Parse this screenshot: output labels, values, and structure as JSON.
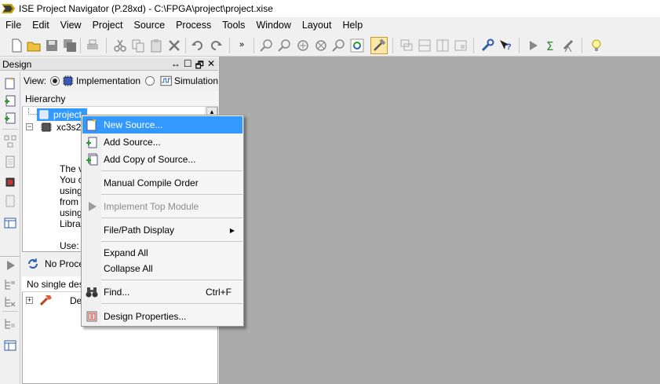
{
  "window": {
    "title": "ISE Project Navigator (P.28xd) - C:\\FPGA\\project\\project.xise"
  },
  "menu": [
    "File",
    "Edit",
    "View",
    "Project",
    "Source",
    "Process",
    "Tools",
    "Window",
    "Layout",
    "Help"
  ],
  "design_panel": {
    "title": "Design",
    "controls": [
      "↔",
      "☐",
      "🗗",
      "✕"
    ],
    "view_label": "View:",
    "view_options": [
      "Implementation",
      "Simulation"
    ],
    "hierarchy_label": "Hierarchy",
    "tree": {
      "project": "project",
      "device": "xc3s20",
      "text_lines": [
        "The v",
        "You c",
        "using",
        "from",
        "using",
        "Librar"
      ],
      "use": "Use:"
    }
  },
  "process_panel": {
    "no_process": "No Proces",
    "no_single": "No single des",
    "design_item": "De"
  },
  "context_menu": {
    "items": [
      {
        "label": "New Source...",
        "highlighted": true,
        "icon": "new-source-icon"
      },
      {
        "label": "Add Source...",
        "icon": "add-source-icon"
      },
      {
        "label": "Add Copy of Source...",
        "icon": "add-copy-source-icon"
      },
      {
        "label": "Manual Compile Order"
      },
      {
        "label": "Implement Top Module",
        "disabled": true,
        "icon": "play-icon"
      },
      {
        "label": "File/Path Display",
        "submenu": true
      },
      {
        "label": "Expand All"
      },
      {
        "label": "Collapse All"
      },
      {
        "label": "Find...",
        "shortcut": "Ctrl+F",
        "icon": "binoculars-icon"
      },
      {
        "label": "Design Properties...",
        "icon": "design-properties-icon"
      }
    ]
  },
  "colors": {
    "highlight": "#3399ff",
    "workspace": "#ababab",
    "panel": "#f0f0f0"
  }
}
